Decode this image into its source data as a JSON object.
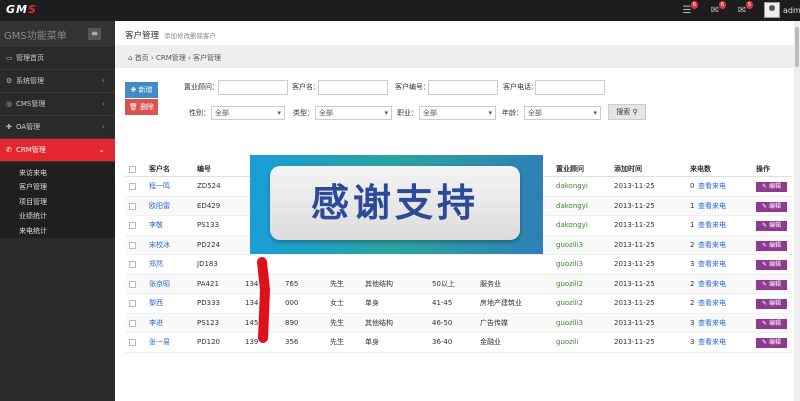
{
  "topbar": {
    "logo_main": "GM",
    "logo_accent": "S",
    "badges": [
      "6",
      "6",
      "5"
    ],
    "user": "admin"
  },
  "sidebar": {
    "title": "GMS功能菜单",
    "items": [
      {
        "label": "管理首页",
        "icon": "monitor-icon"
      },
      {
        "label": "系统管理",
        "icon": "gear-icon"
      },
      {
        "label": "CMS管理",
        "icon": "globe-icon"
      },
      {
        "label": "OA管理",
        "icon": "puzzle-icon"
      },
      {
        "label": "CRM管理",
        "icon": "phone-icon"
      }
    ],
    "sub_items": [
      "来访来电",
      "客户管理",
      "项目管理",
      "业绩统计",
      "来电统计"
    ]
  },
  "page": {
    "title": "客户管理",
    "subtitle": "添加修改删除客户",
    "breadcrumb": [
      "首页",
      "CRM管理",
      "客户管理"
    ]
  },
  "actions": {
    "add": "新增",
    "delete": "删除",
    "search": "搜索"
  },
  "filters": {
    "advisor": "置业顾问：",
    "name": "客户名：",
    "code": "客户编号：",
    "phone": "客户电话：",
    "gender": "性别：",
    "type": "类型：",
    "job": "职业：",
    "age": "年龄：",
    "all": "全部"
  },
  "table": {
    "headers": [
      "客户名",
      "编号",
      "置业顾问",
      "添加时间",
      "来电数",
      "操作"
    ],
    "rows": [
      {
        "name": "程一鸣",
        "code": "ZD524",
        "phone": "",
        "gender": "",
        "type": "",
        "age": "",
        "industry": "",
        "advisor": "dakongyi",
        "date": "2013-11-25",
        "calls": "0",
        "calls_link": "查看来电"
      },
      {
        "name": "欧阳雷",
        "code": "ED429",
        "phone": "",
        "gender": "",
        "type": "",
        "age": "",
        "industry": "",
        "advisor": "dakongyi",
        "date": "2013-11-25",
        "calls": "1",
        "calls_link": "查看来电"
      },
      {
        "name": "李敬",
        "code": "PS133",
        "phone": "",
        "gender": "",
        "type": "",
        "age": "",
        "industry": "",
        "advisor": "dakongyi",
        "date": "2013-11-25",
        "calls": "1",
        "calls_link": "查看来电"
      },
      {
        "name": "宋校冰",
        "code": "PD224",
        "phone": "",
        "gender": "",
        "type": "",
        "age": "",
        "industry": "",
        "advisor": "guozili3",
        "date": "2013-11-25",
        "calls": "2",
        "calls_link": "查看来电"
      },
      {
        "name": "郑然",
        "code": "JD183",
        "phone": "",
        "gender": "",
        "type": "",
        "age": "",
        "industry": "",
        "advisor": "guozili3",
        "date": "2013-11-25",
        "calls": "3",
        "calls_link": "查看来电"
      },
      {
        "name": "张京昭",
        "code": "PA421",
        "phone": "134",
        "phone_end": "765",
        "gender": "先生",
        "type": "其他结构",
        "age": "50以上",
        "industry": "服务业",
        "advisor": "guozili2",
        "date": "2013-11-25",
        "calls": "2",
        "calls_link": "查看来电"
      },
      {
        "name": "黎西",
        "code": "PD333",
        "phone": "134",
        "phone_end": "000",
        "gender": "女士",
        "type": "单身",
        "age": "41-45",
        "industry": "房地产建筑业",
        "advisor": "guozili2",
        "date": "2013-11-25",
        "calls": "2",
        "calls_link": "查看来电"
      },
      {
        "name": "李进",
        "code": "PS123",
        "phone": "145",
        "phone_end": "890",
        "gender": "先生",
        "type": "其他结构",
        "age": "46-50",
        "industry": "广告传媒",
        "advisor": "guozili3",
        "date": "2013-11-25",
        "calls": "3",
        "calls_link": "查看来电"
      },
      {
        "name": "张一易",
        "code": "PD120",
        "phone": "139",
        "phone_end": "356",
        "gender": "先生",
        "type": "单身",
        "age": "36-40",
        "industry": "金融业",
        "advisor": "guozili",
        "date": "2013-11-25",
        "calls": "3",
        "calls_link": "查看来电"
      }
    ],
    "edit_label": "编辑"
  },
  "overlay": {
    "text": "感谢支持"
  }
}
